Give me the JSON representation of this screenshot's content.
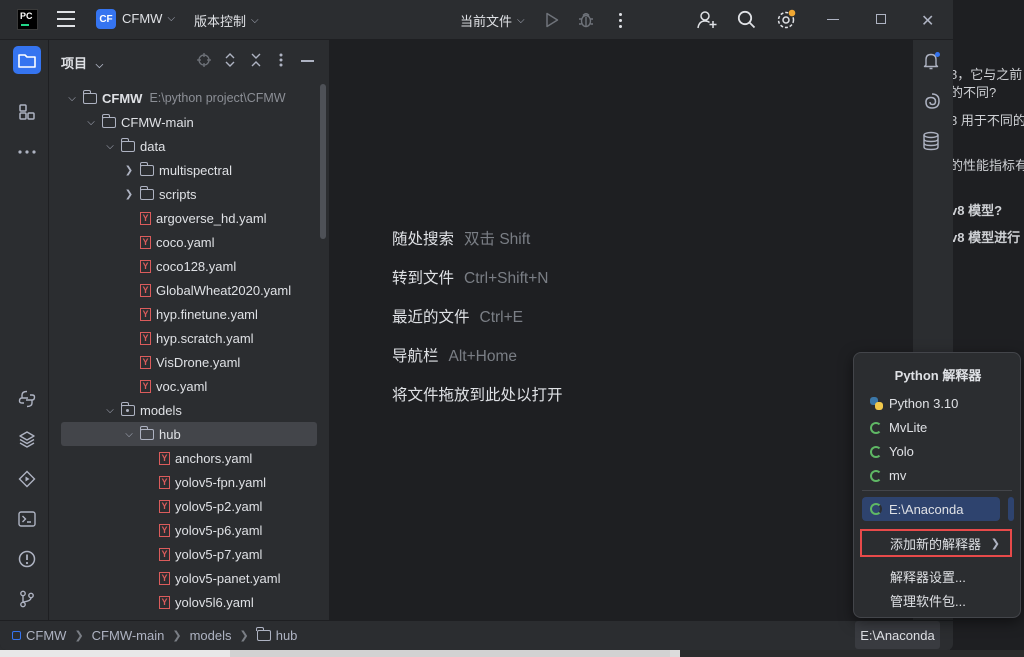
{
  "titlebar": {
    "app_logo": "PC",
    "project_badge": "CF",
    "project_name": "CFMW",
    "vcs_menu": "版本控制",
    "run_config": "当前文件"
  },
  "project_panel": {
    "title": "项目",
    "tree": [
      {
        "label": "CFMW",
        "path": "E:\\python project\\CFMW",
        "type": "folder",
        "expanded": true
      },
      {
        "label": "CFMW-main",
        "type": "folder",
        "expanded": true
      },
      {
        "label": "data",
        "type": "folder",
        "expanded": true
      },
      {
        "label": "multispectral",
        "type": "folder",
        "expanded": false
      },
      {
        "label": "scripts",
        "type": "folder",
        "expanded": false
      },
      {
        "label": "argoverse_hd.yaml",
        "type": "yaml"
      },
      {
        "label": "coco.yaml",
        "type": "yaml"
      },
      {
        "label": "coco128.yaml",
        "type": "yaml"
      },
      {
        "label": "GlobalWheat2020.yaml",
        "type": "yaml"
      },
      {
        "label": "hyp.finetune.yaml",
        "type": "yaml"
      },
      {
        "label": "hyp.scratch.yaml",
        "type": "yaml"
      },
      {
        "label": "VisDrone.yaml",
        "type": "yaml"
      },
      {
        "label": "voc.yaml",
        "type": "yaml"
      },
      {
        "label": "models",
        "type": "package",
        "expanded": true
      },
      {
        "label": "hub",
        "type": "folder",
        "expanded": true,
        "selected": true
      },
      {
        "label": "anchors.yaml",
        "type": "yaml"
      },
      {
        "label": "yolov5-fpn.yaml",
        "type": "yaml"
      },
      {
        "label": "yolov5-p2.yaml",
        "type": "yaml"
      },
      {
        "label": "yolov5-p6.yaml",
        "type": "yaml"
      },
      {
        "label": "yolov5-p7.yaml",
        "type": "yaml"
      },
      {
        "label": "yolov5-panet.yaml",
        "type": "yaml"
      },
      {
        "label": "yolov5l6.yaml",
        "type": "yaml"
      }
    ]
  },
  "editor": {
    "hints": [
      {
        "action": "随处搜索",
        "key": "双击 Shift"
      },
      {
        "action": "转到文件",
        "key": "Ctrl+Shift+N"
      },
      {
        "action": "最近的文件",
        "key": "Ctrl+E"
      },
      {
        "action": "导航栏",
        "key": "Alt+Home"
      },
      {
        "action": "将文件拖放到此处以打开",
        "key": ""
      }
    ]
  },
  "statusbar": {
    "breadcrumb": [
      "CFMW",
      "CFMW-main",
      "models",
      "hub"
    ],
    "interpreter": "E:\\Anaconda"
  },
  "interpreter_popup": {
    "title": "Python 解释器",
    "interpreters": [
      "Python 3.10",
      "MvLite",
      "Yolo",
      "mv"
    ],
    "current": "E:\\Anaconda",
    "add_new": "添加新的解释器",
    "settings": "解释器设置...",
    "manage": "管理软件包..."
  },
  "background_window": {
    "lines": [
      "8，它与之前",
      "的不同?",
      "8 用于不同的",
      "的性能指标有",
      "v8 模型?",
      "v8 模型进行"
    ]
  },
  "colors": {
    "accent": "#3574f0",
    "highlight_border": "#e84a4a",
    "spinner_green": "#5fb865",
    "yaml_red": "#db5c5c"
  }
}
